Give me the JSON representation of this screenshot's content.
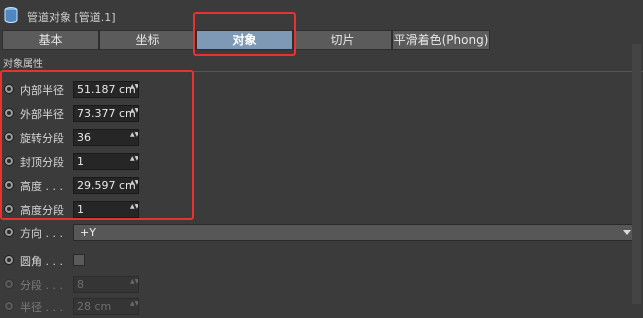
{
  "window": {
    "title": "管道对象 [管道.1]",
    "icon": "pipe-object-icon"
  },
  "tabs": [
    {
      "label": "基本",
      "active": false
    },
    {
      "label": "坐标",
      "active": false
    },
    {
      "label": "对象",
      "active": true
    },
    {
      "label": "切片",
      "active": false
    },
    {
      "label": "平滑着色(Phong)",
      "active": false
    }
  ],
  "section": {
    "title": "对象属性"
  },
  "params": [
    {
      "label": "内部半径",
      "value": "51.187 cm",
      "spinner": "▲▼"
    },
    {
      "label": "外部半径",
      "value": "73.377 cm",
      "spinner": "▲▼"
    },
    {
      "label": "旋转分段",
      "value": "36",
      "spinner": "▲▼"
    },
    {
      "label": "封顶分段",
      "value": "1",
      "spinner": "▲▼"
    },
    {
      "label": "高度 . . .",
      "value": "29.597 cm",
      "spinner": "▲▼"
    },
    {
      "label": "高度分段",
      "value": "1",
      "spinner": "▲▼"
    }
  ],
  "orientation": {
    "label": "方向 . . .",
    "value": "+Y"
  },
  "fillet": {
    "label": "圆角 . . .",
    "checked": false
  },
  "fillet_params": [
    {
      "label": "分段 . . .",
      "value": "8",
      "spinner": "▲▼"
    },
    {
      "label": "半径 . . .",
      "value": "28 cm",
      "spinner": "▲▼"
    }
  ],
  "colors": {
    "accent_tab": "#7d99b6",
    "highlight": "#e8322f",
    "background": "#3b3b3b"
  }
}
